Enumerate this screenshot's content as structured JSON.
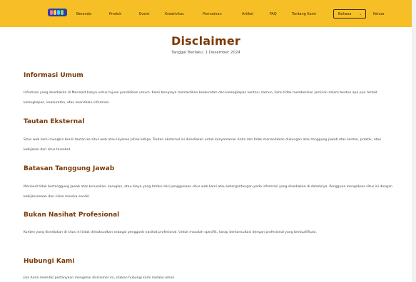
{
  "nav": {
    "items": [
      "Beranda",
      "Produk",
      "Event",
      "Kreativitas",
      "Permainan",
      "Artikel",
      "FAQ",
      "Tentang Kami"
    ],
    "language": "Bahasa",
    "logout": "Keluar"
  },
  "colors": {
    "navbar": "#f6bf26",
    "heading": "#7b3a07"
  },
  "page": {
    "title": "Disclaimer",
    "date": "Tanggal Berlaku: 1 Desember 2024"
  },
  "sections": [
    {
      "heading": "Informasi Umum",
      "text": "Informasi yang disediakan di Marioaid hanya untuk tujuan pendidikan umum. Kami berupaya memastikan keakuratan dan kelengkapan konten; namun, kami tidak memberikan jaminan dalam bentuk apa pun terkait kelengkapan, keakuratan, atau keandalan informasi."
    },
    {
      "heading": "Tautan Eksternal",
      "text": "Situs web kami mungkin berisi tautan ke situs web atau layanan pihak ketiga. Tautan eksternal ini disediakan untuk kenyamanan Anda dan tidak menandakan dukungan atau tanggung jawab atas konten, praktik, atau kebijakan dari situs tersebut."
    },
    {
      "heading": "Batasan Tanggung Jawab",
      "text": "Marioaid tidak bertanggung jawab atas kerusakan, kerugian, atau biaya yang timbul dari penggunaan situs web kami atau ketergantungan pada informasi yang disediakan di dalamnya. Pengguna mengakses situs ini dengan kebijaksanaan dan risiko mereka sendiri."
    },
    {
      "heading": "Bukan Nasihat Profesional",
      "text": "Konten yang disediakan di situs ini tidak dimaksudkan sebagai pengganti nasihat profesional. Untuk masalah spesifik, harap berkonsultasi dengan profesional yang berkualifikasi."
    },
    {
      "heading": "Hubungi Kami",
      "text": "Jika Anda memiliki pertanyaan mengenai disclaimer ini, silakan hubungi kami melalui email."
    }
  ]
}
